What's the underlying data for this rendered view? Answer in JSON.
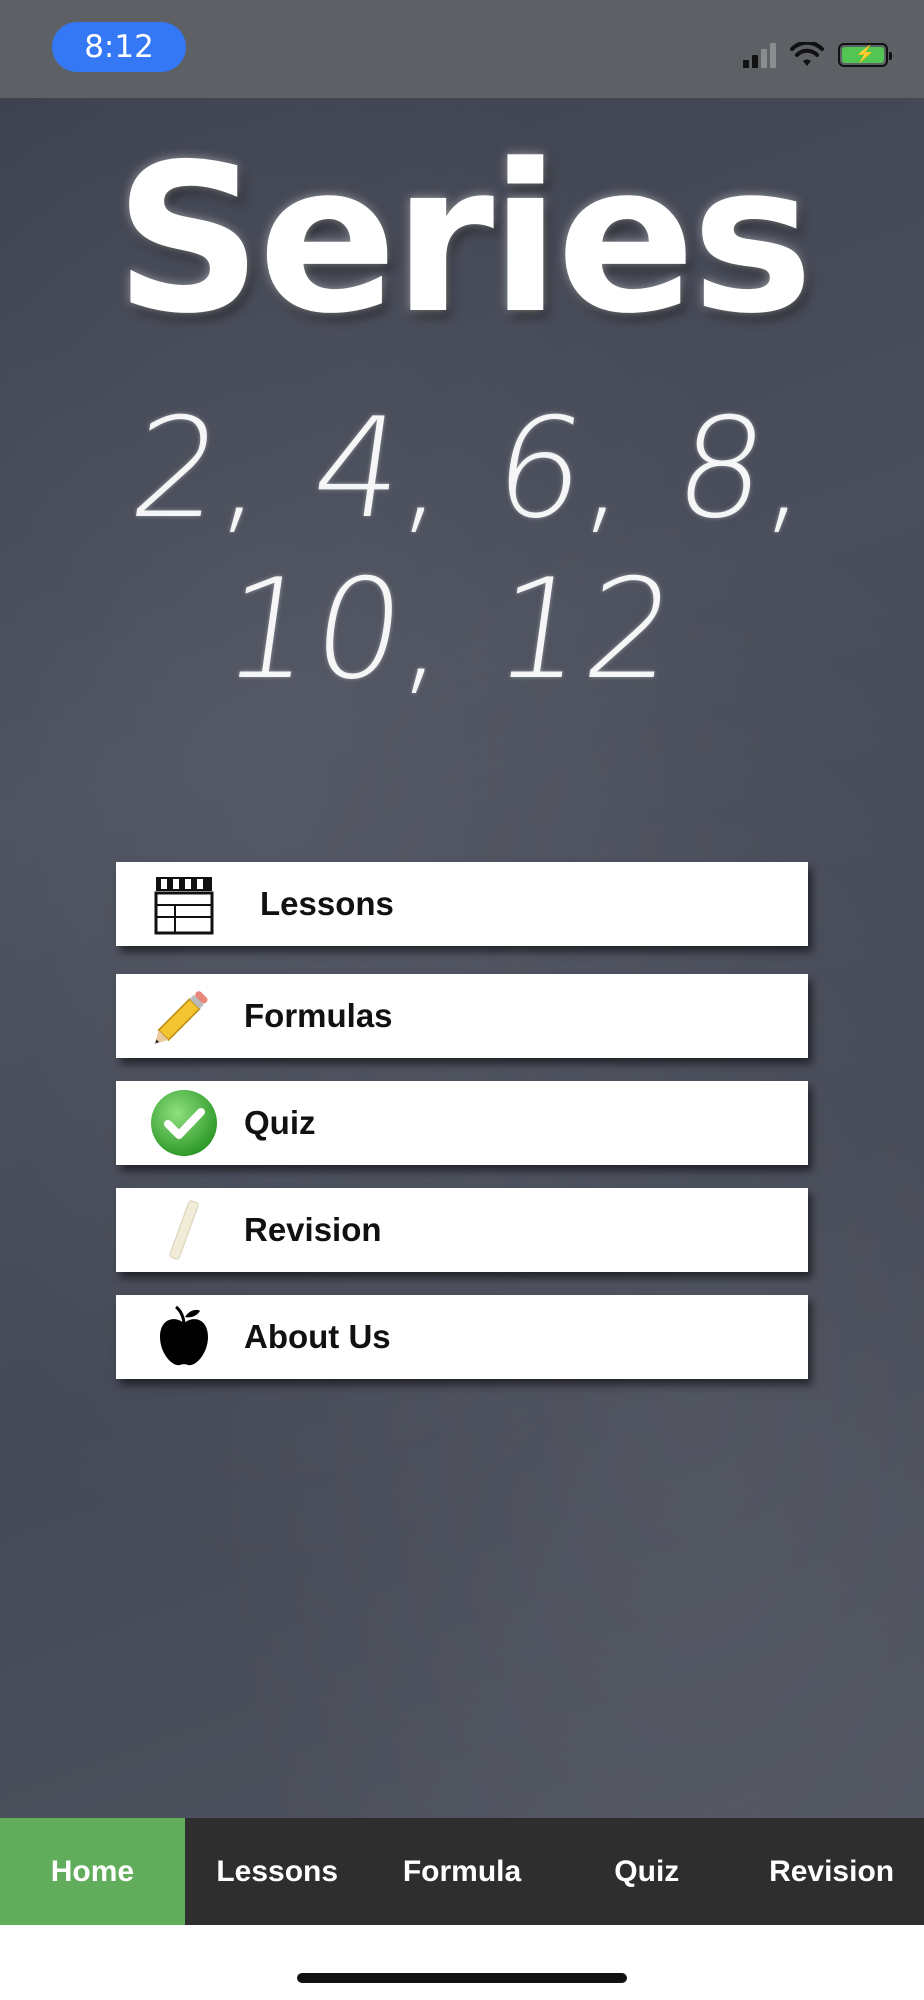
{
  "status_bar": {
    "time": "8:12",
    "colors": {
      "time_pill": "#3478f6",
      "battery_fill": "#53c553"
    },
    "icons": [
      "signal-icon",
      "wifi-icon",
      "battery-charging-icon"
    ]
  },
  "board": {
    "title": "Series",
    "sequence": "2, 4, 6, 8, 10, 12"
  },
  "menu": {
    "items": [
      {
        "label": "Lessons",
        "icon": "clapperboard-icon"
      },
      {
        "label": "Formulas",
        "icon": "pencil-icon"
      },
      {
        "label": "Quiz",
        "icon": "green-checkmark-icon"
      },
      {
        "label": "Revision",
        "icon": "chalk-icon"
      },
      {
        "label": "About Us",
        "icon": "apple-icon"
      }
    ]
  },
  "tab_bar": {
    "active_color": "#62ad5c",
    "tabs": [
      {
        "label": "Home",
        "active": true
      },
      {
        "label": "Lessons",
        "active": false
      },
      {
        "label": "Formula",
        "active": false
      },
      {
        "label": "Quiz",
        "active": false
      },
      {
        "label": "Revision",
        "active": false
      }
    ]
  }
}
